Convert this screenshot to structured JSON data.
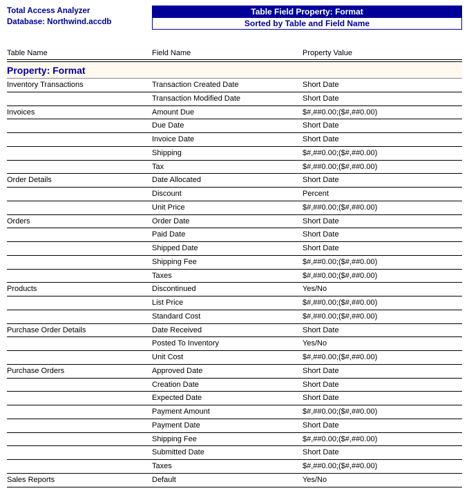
{
  "header": {
    "app_title": "Total Access Analyzer",
    "db_label": "Database: Northwind.accdb",
    "box_title": "Table Field Property: Format",
    "box_sub": "Sorted by Table and Field Name"
  },
  "columns": {
    "c1": "Table Name",
    "c2": "Field Name",
    "c3": "Property Value"
  },
  "group_header": "Property: Format",
  "rows": [
    {
      "table": "Inventory Transactions",
      "field": "Transaction Created Date",
      "value": "Short Date"
    },
    {
      "table": "",
      "field": "Transaction Modified Date",
      "value": "Short Date"
    },
    {
      "table": "Invoices",
      "field": "Amount Due",
      "value": "$#,##0.00;($#,##0.00)"
    },
    {
      "table": "",
      "field": "Due Date",
      "value": "Short Date"
    },
    {
      "table": "",
      "field": "Invoice Date",
      "value": "Short Date"
    },
    {
      "table": "",
      "field": "Shipping",
      "value": "$#,##0.00;($#,##0.00)"
    },
    {
      "table": "",
      "field": "Tax",
      "value": "$#,##0.00;($#,##0.00)"
    },
    {
      "table": "Order Details",
      "field": "Date Allocated",
      "value": "Short Date"
    },
    {
      "table": "",
      "field": "Discount",
      "value": "Percent"
    },
    {
      "table": "",
      "field": "Unit Price",
      "value": "$#,##0.00;($#,##0.00)"
    },
    {
      "table": "Orders",
      "field": "Order Date",
      "value": "Short Date"
    },
    {
      "table": "",
      "field": "Paid Date",
      "value": "Short Date"
    },
    {
      "table": "",
      "field": "Shipped Date",
      "value": "Short Date"
    },
    {
      "table": "",
      "field": "Shipping Fee",
      "value": "$#,##0.00;($#,##0.00)"
    },
    {
      "table": "",
      "field": "Taxes",
      "value": "$#,##0.00;($#,##0.00)"
    },
    {
      "table": "Products",
      "field": "Discontinued",
      "value": "Yes/No"
    },
    {
      "table": "",
      "field": "List Price",
      "value": "$#,##0.00;($#,##0.00)"
    },
    {
      "table": "",
      "field": "Standard Cost",
      "value": "$#,##0.00;($#,##0.00)"
    },
    {
      "table": "Purchase Order Details",
      "field": "Date Received",
      "value": "Short Date"
    },
    {
      "table": "",
      "field": "Posted To Inventory",
      "value": "Yes/No"
    },
    {
      "table": "",
      "field": "Unit Cost",
      "value": "$#,##0.00;($#,##0.00)"
    },
    {
      "table": "Purchase Orders",
      "field": "Approved Date",
      "value": "Short Date"
    },
    {
      "table": "",
      "field": "Creation Date",
      "value": "Short Date"
    },
    {
      "table": "",
      "field": "Expected Date",
      "value": "Short Date"
    },
    {
      "table": "",
      "field": "Payment Amount",
      "value": "$#,##0.00;($#,##0.00)"
    },
    {
      "table": "",
      "field": "Payment Date",
      "value": "Short Date"
    },
    {
      "table": "",
      "field": "Shipping Fee",
      "value": "$#,##0.00;($#,##0.00)"
    },
    {
      "table": "",
      "field": "Submitted Date",
      "value": "Short Date"
    },
    {
      "table": "",
      "field": "Taxes",
      "value": "$#,##0.00;($#,##0.00)"
    },
    {
      "table": "Sales Reports",
      "field": "Default",
      "value": "Yes/No"
    }
  ]
}
